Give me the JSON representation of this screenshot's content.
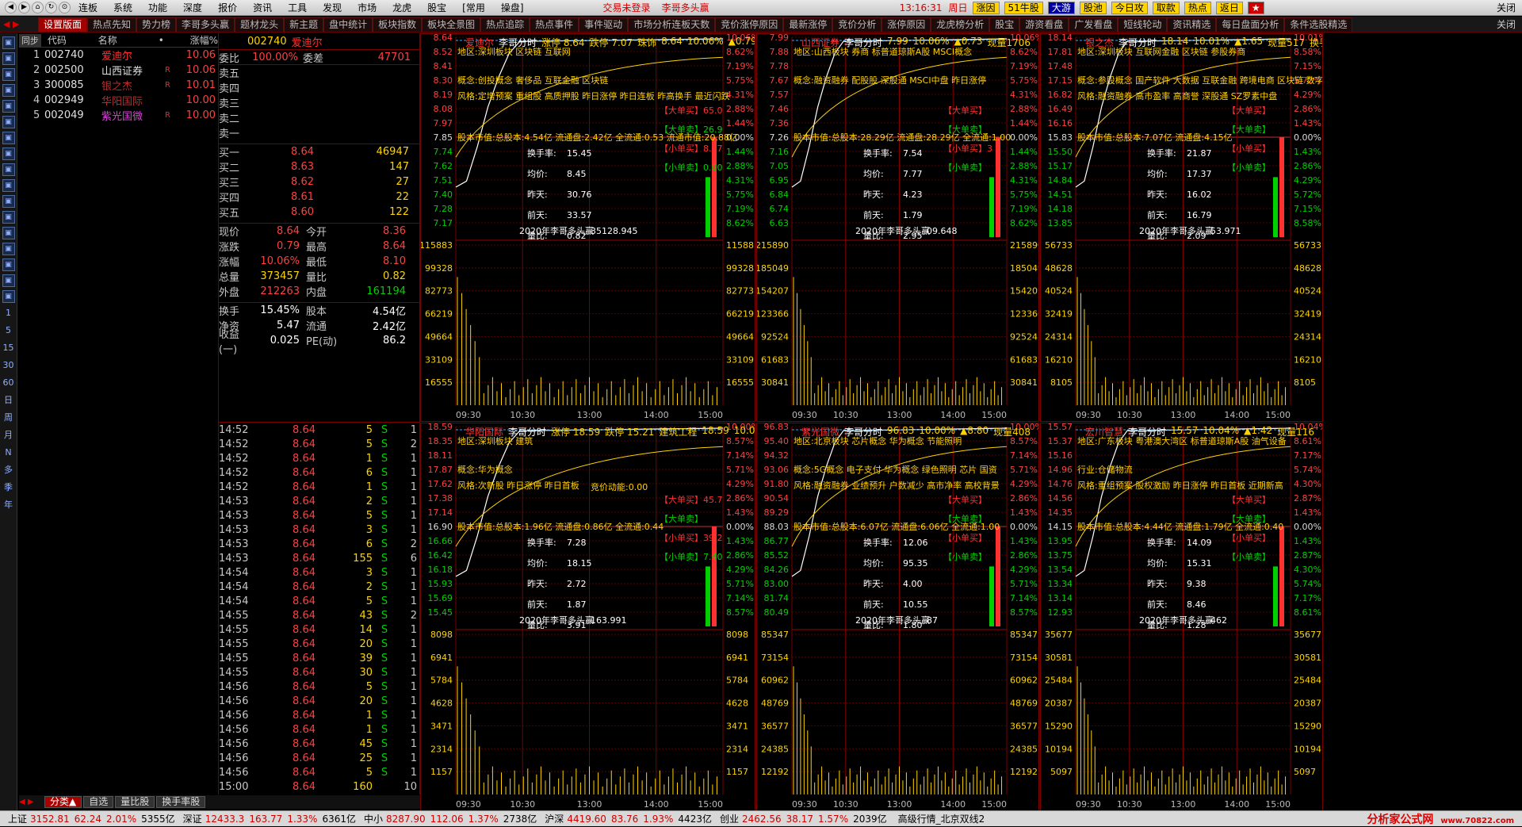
{
  "menubar": {
    "nav_icons": [
      "back-icon",
      "forward-icon",
      "home-icon",
      "refresh-icon",
      "link-icon"
    ],
    "items": [
      "连板",
      "系统",
      "功能",
      "深度",
      "报价",
      "资讯",
      "工具",
      "发现",
      "市场",
      "龙虎",
      "股宝",
      "[常用",
      "操盘]"
    ],
    "status": "交易未登录",
    "title": "李哥多头赢",
    "time": "13:16:31",
    "weekday": "周日",
    "quick_buttons": [
      "涨因",
      "51牛股",
      "大游",
      "股池",
      "今日攻",
      "取款",
      "热点",
      "返日",
      "★"
    ],
    "close_label": "关闭"
  },
  "tabs": [
    "设置版面",
    "热点先知",
    "势力榜",
    "李哥多头赢",
    "题材龙头",
    "新主题",
    "盘中统计",
    "板块指数",
    "板块全景图",
    "热点追踪",
    "热点事件",
    "事件驱动",
    "市场分析连板天数",
    "竞价涨停原因",
    "最新涨停",
    "竞价分析",
    "涨停原因",
    "龙虎榜分析",
    "股宝",
    "游资看盘",
    "广发看盘",
    "短线轮动",
    "资讯精选",
    "每日盘面分析",
    "条件选股精选"
  ],
  "tabs_close": "关闭",
  "leftbar": {
    "icons": [
      "up-arrow-icon",
      "down-arrow-icon",
      "grid-icon",
      "list-icon",
      "chart-icon",
      "bar-icon",
      "candle-icon",
      "table-icon",
      "fund-icon",
      "report-icon",
      "doc-icon",
      "fz-icon",
      "info-icon",
      "globe-icon",
      "quote-icon",
      "pen-icon",
      "calc-icon"
    ],
    "periods": [
      "1",
      "5",
      "15",
      "30",
      "60",
      "日",
      "周",
      "月",
      "N",
      "多",
      "季",
      "年"
    ]
  },
  "list": {
    "headers": [
      "同步",
      "代码",
      "名称",
      "•",
      "涨幅%"
    ],
    "rows": [
      {
        "idx": "1",
        "code": "002740",
        "name": "爱迪尔",
        "flag": "",
        "pct": "10.06",
        "color": "#ff3030"
      },
      {
        "idx": "2",
        "code": "002500",
        "name": "山西证券",
        "flag": "R",
        "pct": "10.06",
        "color": "#e0e0e0"
      },
      {
        "idx": "3",
        "code": "300085",
        "name": "银之杰",
        "flag": "R",
        "pct": "10.01",
        "color": "#b03030"
      },
      {
        "idx": "4",
        "code": "002949",
        "name": "华阳国际",
        "flag": "",
        "pct": "10.00",
        "color": "#b03030"
      },
      {
        "idx": "5",
        "code": "002049",
        "name": "紫光国微",
        "flag": "R",
        "pct": "10.00",
        "color": "#e040e0"
      }
    ]
  },
  "quote": {
    "code": "002740",
    "name": "爱迪尔",
    "weibi_label": "委比",
    "weibi": "100.00%",
    "weicha_label": "委差",
    "weicha": "47701",
    "asks": [
      {
        "label": "卖五",
        "price": "",
        "vol": ""
      },
      {
        "label": "卖四",
        "price": "",
        "vol": ""
      },
      {
        "label": "卖三",
        "price": "",
        "vol": ""
      },
      {
        "label": "卖二",
        "price": "",
        "vol": ""
      },
      {
        "label": "卖一",
        "price": "",
        "vol": ""
      }
    ],
    "bids": [
      {
        "label": "买一",
        "price": "8.64",
        "vol": "46947"
      },
      {
        "label": "买二",
        "price": "8.63",
        "vol": "147"
      },
      {
        "label": "买三",
        "price": "8.62",
        "vol": "27"
      },
      {
        "label": "买四",
        "price": "8.61",
        "vol": "22"
      },
      {
        "label": "买五",
        "price": "8.60",
        "vol": "122"
      }
    ],
    "stats": [
      {
        "l1": "现价",
        "v1": "8.64",
        "c1": "#ff4040",
        "l2": "今开",
        "v2": "8.36",
        "c2": "#ff4040"
      },
      {
        "l1": "涨跌",
        "v1": "0.79",
        "c1": "#ff4040",
        "l2": "最高",
        "v2": "8.64",
        "c2": "#ff4040"
      },
      {
        "l1": "涨幅",
        "v1": "10.06%",
        "c1": "#ff4040",
        "l2": "最低",
        "v2": "8.10",
        "c2": "#ff4040"
      },
      {
        "l1": "总量",
        "v1": "373457",
        "c1": "#ffd400",
        "l2": "量比",
        "v2": "0.82",
        "c2": "#ffd400"
      },
      {
        "l1": "外盘",
        "v1": "212263",
        "c1": "#ff4040",
        "l2": "内盘",
        "v2": "161194",
        "c2": "#00d000"
      }
    ],
    "stats2": [
      {
        "l1": "换手",
        "v1": "15.45%",
        "c1": "#ffffff",
        "l2": "股本",
        "v2": "4.54亿",
        "c2": "#ffffff"
      },
      {
        "l1": "净资",
        "v1": "5.47",
        "c1": "#ffffff",
        "l2": "流通",
        "v2": "2.42亿",
        "c2": "#ffffff"
      },
      {
        "l1": "收益(一)",
        "v1": "0.025",
        "c1": "#ffffff",
        "l2": "PE(动)",
        "v2": "86.2",
        "c2": "#ffffff"
      }
    ]
  },
  "ticks": [
    {
      "t": "14:52",
      "p": "8.64",
      "v": "5",
      "s": "S",
      "n": "1"
    },
    {
      "t": "14:52",
      "p": "8.64",
      "v": "5",
      "s": "S",
      "n": "2"
    },
    {
      "t": "14:52",
      "p": "8.64",
      "v": "1",
      "s": "S",
      "n": "1"
    },
    {
      "t": "14:52",
      "p": "8.64",
      "v": "6",
      "s": "S",
      "n": "1"
    },
    {
      "t": "14:52",
      "p": "8.64",
      "v": "1",
      "s": "S",
      "n": "1"
    },
    {
      "t": "14:53",
      "p": "8.64",
      "v": "2",
      "s": "S",
      "n": "1"
    },
    {
      "t": "14:53",
      "p": "8.64",
      "v": "5",
      "s": "S",
      "n": "1"
    },
    {
      "t": "14:53",
      "p": "8.64",
      "v": "3",
      "s": "S",
      "n": "1"
    },
    {
      "t": "14:53",
      "p": "8.64",
      "v": "6",
      "s": "S",
      "n": "2"
    },
    {
      "t": "14:53",
      "p": "8.64",
      "v": "155",
      "s": "S",
      "n": "6"
    },
    {
      "t": "14:54",
      "p": "8.64",
      "v": "3",
      "s": "S",
      "n": "1"
    },
    {
      "t": "14:54",
      "p": "8.64",
      "v": "2",
      "s": "S",
      "n": "1"
    },
    {
      "t": "14:54",
      "p": "8.64",
      "v": "5",
      "s": "S",
      "n": "1"
    },
    {
      "t": "14:55",
      "p": "8.64",
      "v": "43",
      "s": "S",
      "n": "2"
    },
    {
      "t": "14:55",
      "p": "8.64",
      "v": "14",
      "s": "S",
      "n": "1"
    },
    {
      "t": "14:55",
      "p": "8.64",
      "v": "20",
      "s": "S",
      "n": "1"
    },
    {
      "t": "14:55",
      "p": "8.64",
      "v": "39",
      "s": "S",
      "n": "1"
    },
    {
      "t": "14:55",
      "p": "8.64",
      "v": "30",
      "s": "S",
      "n": "1"
    },
    {
      "t": "14:56",
      "p": "8.64",
      "v": "5",
      "s": "S",
      "n": "1"
    },
    {
      "t": "14:56",
      "p": "8.64",
      "v": "20",
      "s": "S",
      "n": "1"
    },
    {
      "t": "14:56",
      "p": "8.64",
      "v": "1",
      "s": "S",
      "n": "1"
    },
    {
      "t": "14:56",
      "p": "8.64",
      "v": "1",
      "s": "S",
      "n": "1"
    },
    {
      "t": "14:56",
      "p": "8.64",
      "v": "45",
      "s": "S",
      "n": "1"
    },
    {
      "t": "14:56",
      "p": "8.64",
      "v": "25",
      "s": "S",
      "n": "1"
    },
    {
      "t": "14:56",
      "p": "8.64",
      "v": "5",
      "s": "S",
      "n": "1"
    },
    {
      "t": "15:00",
      "p": "8.64",
      "v": "160",
      "s": "",
      "n": "10"
    }
  ],
  "bottom_tabs": [
    "分类▲",
    "自选",
    "量比股",
    "换手率股"
  ],
  "panels": [
    {
      "name": "爱迪尔",
      "hdr": [
        "李哥分时",
        "涨停 8.64",
        "跌停 7.07",
        "珠饰",
        "8.64",
        "10.06%",
        "▲0.79",
        "现量160"
      ],
      "price_labels": [
        "8.64",
        "8.52",
        "8.41",
        "8.30",
        "8.19",
        "8.08",
        "7.97",
        "7.85",
        "7.74",
        "7.62",
        "7.51",
        "7.40",
        "7.28",
        "7.17"
      ],
      "pct_labels": [
        "10.06%",
        "8.62%",
        "7.19%",
        "5.75%",
        "4.31%",
        "2.88%",
        "1.44%",
        "0.00%",
        "1.44%",
        "2.88%",
        "4.31%",
        "5.75%",
        "7.19%",
        "8.62%"
      ],
      "vol_labels": [
        "115883",
        "99328",
        "82773",
        "66219",
        "49664",
        "33109",
        "16555"
      ],
      "concepts": "地区:深圳板块 区块链 互联网",
      "tags": "概念:创投概念 奢侈品 互联金融 区块链",
      "tags2": "风格:定增预案 重组股 高质押股 昨日涨停 昨日连板 昨高换手 最近闪跌",
      "mktcap": "股本市值:总股本:4.54亿 流通盘:2.42亿 全流通:0.53 流通市值:20.88亿",
      "stats": [
        [
          "换手率:",
          "15.45"
        ],
        [
          "均价:",
          "8.45"
        ],
        [
          "昨天:",
          "30.76"
        ],
        [
          "前天:",
          "33.57"
        ],
        [
          "量比:",
          "0.82"
        ]
      ],
      "footer": "2020年李哥多头赢",
      "footer2": "35128.945",
      "side": [
        "【大单买】65.0",
        "【大单卖】26.9",
        "【小单买】8.07",
        "【小单卖】0.00"
      ],
      "times": [
        "09:30",
        "10:30",
        "13:00",
        "14:00",
        "15:00"
      ]
    },
    {
      "name": "山西证券",
      "hdr": [
        "李哥分时",
        "7.99",
        "10.06%",
        "▲0.73",
        "现量1706"
      ],
      "price_labels": [
        "7.99",
        "7.88",
        "7.78",
        "7.67",
        "7.57",
        "7.46",
        "7.36",
        "7.26",
        "7.16",
        "7.05",
        "6.95",
        "6.84",
        "6.74",
        "6.63"
      ],
      "pct_labels": [
        "10.06%",
        "8.62%",
        "7.19%",
        "5.75%",
        "4.31%",
        "2.88%",
        "1.44%",
        "0.00%",
        "1.44%",
        "2.88%",
        "4.31%",
        "5.75%",
        "7.19%",
        "8.62%"
      ],
      "vol_labels": [
        "215890",
        "185049",
        "154207",
        "123366",
        "92524",
        "61683",
        "30841"
      ],
      "concepts": "地区:山西板块 券商 标普道琼斯A股 MSCI概念",
      "tags": "概念:融资融券 配股股 深股通 MSCI中盘 昨日涨停",
      "tags2": "",
      "mktcap": "股本市值:总股本:28.29亿 流通盘:28.29亿 全流通:1.00",
      "stats": [
        [
          "换手率:",
          "7.54"
        ],
        [
          "均价:",
          "7.77"
        ],
        [
          "昨天:",
          "4.23"
        ],
        [
          "前天:",
          "1.79"
        ],
        [
          "量比:",
          "2.95"
        ]
      ],
      "footer": "2020年李哥多头赢",
      "footer2": "09.648",
      "side": [
        "【大单买】",
        "【大单卖】",
        "【小单买】3",
        "【小单卖】"
      ],
      "times": [
        "09:30",
        "10:30",
        "13:00",
        "14:00",
        "15:00"
      ]
    },
    {
      "name": "银之杰",
      "hdr": [
        "李哥分时",
        "18.14",
        "10.01%",
        "▲1.65",
        "现量517",
        "换手21.87%"
      ],
      "price_labels": [
        "18.14",
        "17.81",
        "17.48",
        "17.15",
        "16.82",
        "16.49",
        "16.16",
        "15.83",
        "15.50",
        "15.17",
        "14.84",
        "14.51",
        "14.18",
        "13.85"
      ],
      "pct_labels": [
        "10.01%",
        "8.58%",
        "7.15%",
        "5.72%",
        "4.29%",
        "2.86%",
        "1.43%",
        "0.00%",
        "1.43%",
        "2.86%",
        "4.29%",
        "5.72%",
        "7.15%",
        "8.58%"
      ],
      "vol_labels": [
        "56733",
        "48628",
        "40524",
        "32419",
        "24314",
        "16210",
        "8105"
      ],
      "concepts": "地区:深圳板块 互联网金融 区块链 参股券商",
      "tags": "概念:参股概念 国产软件 大数据 互联金融 跨境电商 区块链 数字货币",
      "tags2": "风格:融资融券 高市盈率 高商誉 深股通 SZ罗素中盘",
      "mktcap": "股本市值:总股本:7.07亿 流通盘:4.15亿",
      "stats": [
        [
          "换手率:",
          "21.87"
        ],
        [
          "均价:",
          "17.37"
        ],
        [
          "昨天:",
          "16.02"
        ],
        [
          "前天:",
          "16.79"
        ],
        [
          "量比:",
          "2.09"
        ]
      ],
      "footer": "2020年李哥多头赢",
      "footer2": "53.971",
      "side": [
        "【大单买】",
        "【大单卖】",
        "【小单买】",
        "【小单卖】"
      ],
      "times": [
        "09:30",
        "10:30",
        "13:00",
        "14:00",
        "15:00"
      ]
    },
    {
      "name": "华阳国际",
      "hdr": [
        "李哥分时",
        "涨停 18.59",
        "跌停 15.21",
        "建筑工程",
        "18.59",
        "10.00%"
      ],
      "price_labels": [
        "18.59",
        "18.35",
        "18.11",
        "17.87",
        "17.62",
        "17.38",
        "17.14",
        "16.90",
        "16.66",
        "16.42",
        "16.18",
        "15.93",
        "15.69",
        "15.45"
      ],
      "pct_labels": [
        "10.00%",
        "8.57%",
        "7.14%",
        "5.71%",
        "4.29%",
        "2.86%",
        "1.43%",
        "0.00%",
        "1.43%",
        "2.86%",
        "4.29%",
        "5.71%",
        "7.14%",
        "8.57%"
      ],
      "vol_labels": [
        "8098",
        "6941",
        "5784",
        "4628",
        "3471",
        "2314",
        "1157"
      ],
      "concepts": "地区:深圳板块 建筑",
      "tags": "概念:华为概念",
      "tags2": "风格:次新股 昨日涨停 昨日首板",
      "mktcap": "股本市值:总股本:1.96亿 流通盘:0.86亿 全流通:0.44",
      "stats": [
        [
          "换手率:",
          "7.28"
        ],
        [
          "均价:",
          "18.15"
        ],
        [
          "昨天:",
          "2.72"
        ],
        [
          "前天:",
          "1.87"
        ],
        [
          "量比:",
          "3.91"
        ]
      ],
      "footer": "2020年李哥多头赢",
      "footer2": "163.991",
      "extra": "竞价动能:0.00",
      "side": [
        "【大单买】45.7",
        "【大单卖】",
        "【小单买】39.2",
        "【小单卖】7.40"
      ],
      "times": [
        "09:30",
        "10:30",
        "13:00",
        "14:00",
        "15:00"
      ]
    },
    {
      "name": "紫光国微",
      "hdr": [
        "李哥分时",
        "96.83",
        "10.00%",
        "▲8.80",
        "现量408"
      ],
      "price_labels": [
        "96.83",
        "95.40",
        "94.32",
        "93.06",
        "91.80",
        "90.54",
        "89.29",
        "88.03",
        "86.77",
        "85.52",
        "84.26",
        "83.00",
        "81.74",
        "80.49"
      ],
      "pct_labels": [
        "10.00%",
        "8.57%",
        "7.14%",
        "5.71%",
        "4.29%",
        "2.86%",
        "1.43%",
        "0.00%",
        "1.43%",
        "2.86%",
        "4.29%",
        "5.71%",
        "7.14%",
        "8.57%"
      ],
      "vol_labels": [
        "85347",
        "73154",
        "60962",
        "48769",
        "36577",
        "24385",
        "12192"
      ],
      "concepts": "地区:北京板块 芯片概念 华为概念 节能照明",
      "tags": "概念:5G概念 电子支付 华为概念 绿色照明 芯片 国资",
      "tags2": "风格:融资融券 业绩预升 户数减少 高市净率 高校背景",
      "mktcap": "股本市值:总股本:6.07亿 流通盘:6.06亿 全流通:1.00",
      "stats": [
        [
          "换手率:",
          "12.06"
        ],
        [
          "均价:",
          "95.35"
        ],
        [
          "昨天:",
          "4.00"
        ],
        [
          "前天:",
          "10.55"
        ],
        [
          "量比:",
          "1.80"
        ]
      ],
      "footer": "2020年李哥多头赢",
      "footer2": "87",
      "side": [
        "【大单买】",
        "【大单卖】",
        "【小单买】",
        "【小单卖】"
      ],
      "times": [
        "09:30",
        "10:30",
        "13:00",
        "14:00",
        "15:00"
      ]
    },
    {
      "name": "宏川智慧",
      "hdr": [
        "李哥分时",
        "15.57",
        "10.04%",
        "▲1.42",
        "现量116"
      ],
      "price_labels": [
        "15.57",
        "15.37",
        "15.16",
        "14.96",
        "14.76",
        "14.56",
        "14.35",
        "14.15",
        "13.95",
        "13.75",
        "13.54",
        "13.34",
        "13.14",
        "12.93"
      ],
      "pct_labels": [
        "10.04%",
        "8.61%",
        "7.17%",
        "5.74%",
        "4.30%",
        "2.87%",
        "1.43%",
        "0.00%",
        "1.43%",
        "2.87%",
        "4.30%",
        "5.74%",
        "7.17%",
        "8.61%"
      ],
      "vol_labels": [
        "35677",
        "30581",
        "25484",
        "20387",
        "15290",
        "10194",
        "5097"
      ],
      "concepts": "地区:广东板块 粤港澳大湾区 标普道琼斯A股 油气设备",
      "tags": "行业:仓储物流",
      "tags2": "风格:重组预案 股权激励 昨日涨停 昨日首板 近期新高",
      "mktcap": "股本市值:总股本:4.44亿 流通盘:1.79亿 全流通:0.40",
      "stats": [
        [
          "换手率:",
          "14.09"
        ],
        [
          "均价:",
          "15.31"
        ],
        [
          "昨天:",
          "9.38"
        ],
        [
          "前天:",
          "8.46"
        ],
        [
          "量比:",
          "1.28"
        ]
      ],
      "footer": "2020年李哥多头赢",
      "footer2": "462",
      "side": [
        "【大单买】",
        "【大单卖】",
        "【小单买】",
        "【小单卖】"
      ],
      "times": [
        "09:30",
        "10:30",
        "13:00",
        "14:00",
        "15:00"
      ]
    }
  ],
  "statusbar": {
    "indices": [
      {
        "name": "上证",
        "vals": [
          "3152.81",
          "62.24",
          "2.01%",
          "5355亿"
        ]
      },
      {
        "name": "深证",
        "vals": [
          "12433.3",
          "163.77",
          "1.33%",
          "6361亿"
        ]
      },
      {
        "name": "中小",
        "vals": [
          "8287.90",
          "112.06",
          "1.37%",
          "2738亿"
        ]
      },
      {
        "name": "沪深",
        "vals": [
          "4419.60",
          "83.76",
          "1.93%",
          "4423亿"
        ]
      },
      {
        "name": "创业",
        "vals": [
          "2462.56",
          "38.17",
          "1.57%",
          "2039亿"
        ]
      }
    ],
    "feed": "高级行情_北京双线2",
    "logo": "分析家公式网",
    "logo_url": "www.70822.com"
  },
  "colors": {
    "up": "#ff4040",
    "down": "#00d000",
    "grid": "#7a0000",
    "accent": "#ffd400"
  }
}
